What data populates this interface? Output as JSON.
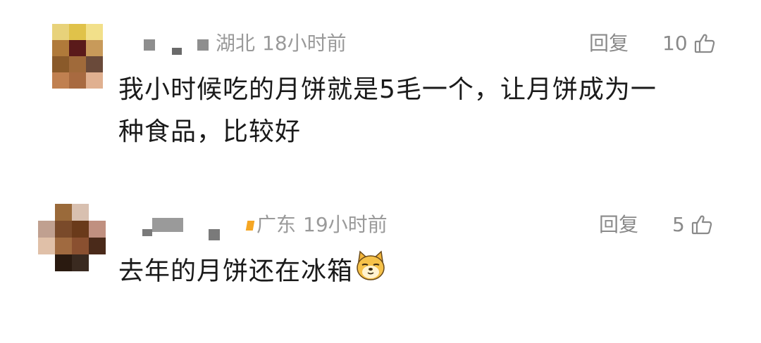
{
  "comments": [
    {
      "location": "湖北",
      "time": "18小时前",
      "reply_label": "回复",
      "like_count": "10",
      "text_line1": "我小时候吃的月饼就是5毛一个，让月饼成为一",
      "text_line2": "种食品，比较好",
      "avatar_colors": [
        "#e8d27a",
        "#e0c24a",
        "#f2e08a",
        "#b07a3a",
        "#5a1a1a",
        "#c89a5a",
        "#8a5a2a",
        "#a06a3a",
        "#6a4a3a",
        "#c08050",
        "#a86a40",
        "#e0b090"
      ]
    },
    {
      "location": "广东",
      "time": "19小时前",
      "reply_label": "回复",
      "like_count": "5",
      "text_line1": "去年的月饼还在冰箱",
      "emoji_name": "doge-emoji-icon",
      "avatar_colors": [
        "#ffffff",
        "#9a6a3a",
        "#d8c0b0",
        "#ffffff",
        "#c0a090",
        "#7a4a2a",
        "#6a3a1a",
        "#c09080",
        "#e0c0a8",
        "#a06a40",
        "#8a5030",
        "#4a2a1a",
        "#ffffff",
        "#2a1a10",
        "#3a2a20",
        "#ffffff"
      ]
    }
  ]
}
